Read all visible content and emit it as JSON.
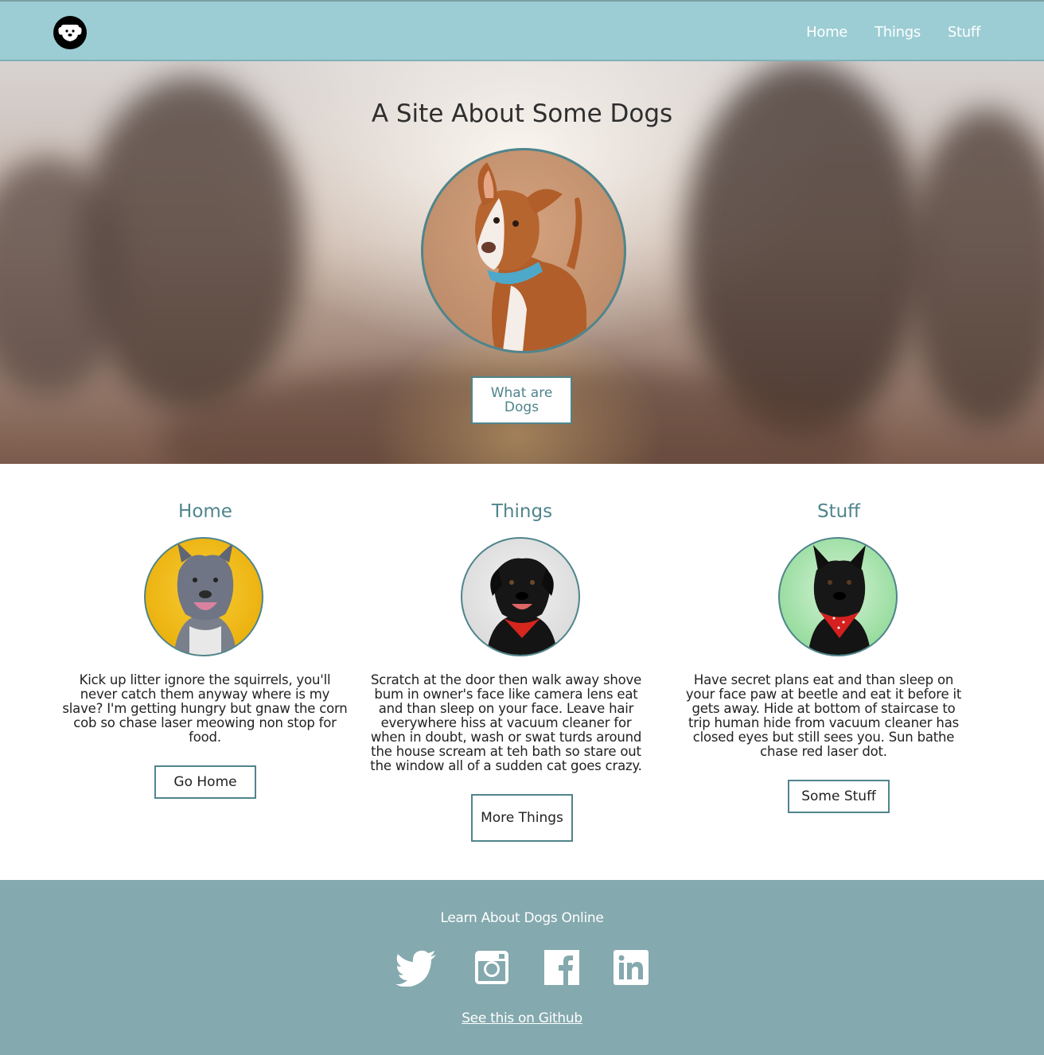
{
  "nav": {
    "logo_icon": "dog-face-icon",
    "links": [
      {
        "label": "Home"
      },
      {
        "label": "Things"
      },
      {
        "label": "Stuff"
      }
    ]
  },
  "hero": {
    "title": "A Site About Some Dogs",
    "image": "brown-white-pit-bull-dog-photo",
    "button_label": "What are Dogs"
  },
  "features": [
    {
      "title": "Home",
      "image": "grey-pit-bull-yellow-background-photo",
      "text": "Kick up litter ignore the squirrels, you'll never catch them anyway where is my slave? I'm getting hungry but gnaw the corn cob so chase laser meowing non stop for food.",
      "button_label": "Go Home"
    },
    {
      "title": "Things",
      "image": "black-dog-red-bandana-grey-background-photo",
      "text": "Scratch at the door then walk away shove bum in owner's face like camera lens eat and than sleep on your face. Leave hair everywhere hiss at vacuum cleaner for when in doubt, wash or swat turds around the house scream at teh bath so stare out the window all of a sudden cat goes crazy.",
      "button_label": "More Things"
    },
    {
      "title": "Stuff",
      "image": "black-dog-red-bandana-green-background-photo",
      "text": "Have secret plans eat and than sleep on your face paw at beetle and eat it before it gets away. Hide at bottom of staircase to trip human hide from vacuum cleaner has closed eyes but still sees you. Sun bathe chase red laser dot.",
      "button_label": "Some Stuff"
    }
  ],
  "footer": {
    "heading": "Learn About Dogs Online",
    "social": [
      "twitter-icon",
      "instagram-icon",
      "facebook-icon",
      "linkedin-icon"
    ],
    "github_link": "See this on Github"
  },
  "colors": {
    "nav_bg": "#9ccdd4",
    "accent": "#4f858c",
    "footer_bg": "#84a9ae"
  }
}
